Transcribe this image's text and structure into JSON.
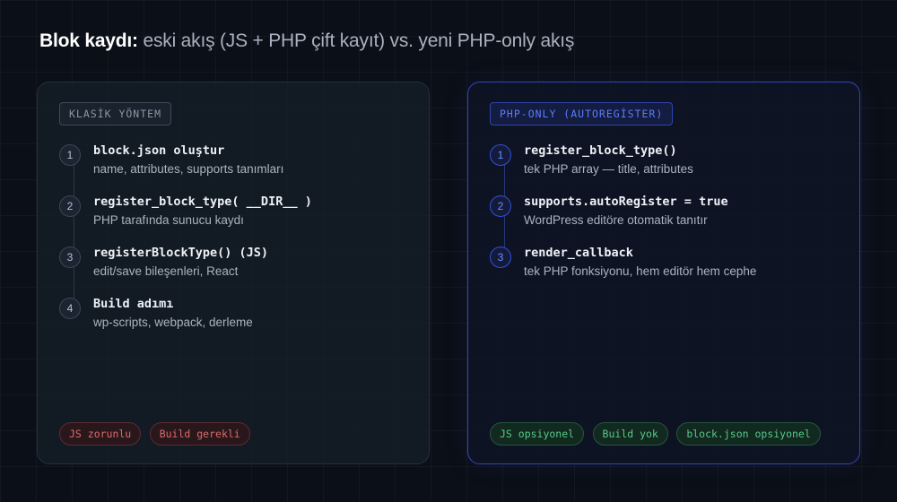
{
  "title": {
    "strong": "Blok kaydı:",
    "rest": "eski akış (JS + PHP çift kayıt) vs. yeni PHP-only akış"
  },
  "left_panel": {
    "label": "KLASİK YÖNTEM",
    "steps": [
      {
        "num": "1",
        "title": "block.json oluştur",
        "desc": "name, attributes, supports tanımları"
      },
      {
        "num": "2",
        "title": "register_block_type( __DIR__ )",
        "desc": "PHP tarafında sunucu kaydı"
      },
      {
        "num": "3",
        "title": "registerBlockType() (JS)",
        "desc": "edit/save bileşenleri, React"
      },
      {
        "num": "4",
        "title": "Build adımı",
        "desc": "wp-scripts, webpack, derleme"
      }
    ],
    "tags": [
      "JS zorunlu",
      "Build gerekli"
    ]
  },
  "right_panel": {
    "label": "PHP-ONLY (AUTOREGİSTER)",
    "steps": [
      {
        "num": "1",
        "title": "register_block_type()",
        "desc": "tek PHP array — title, attributes"
      },
      {
        "num": "2",
        "title": "supports.autoRegister = true",
        "desc": "WordPress editöre otomatik tanıtır"
      },
      {
        "num": "3",
        "title": "render_callback",
        "desc": "tek PHP fonksiyonu, hem editör hem cephe"
      }
    ],
    "tags": [
      "JS opsiyonel",
      "Build yok",
      "block.json opsiyonel"
    ]
  },
  "colors": {
    "background": "#0b0f17",
    "accent_blue": "#3345b8",
    "tag_red": "#d96b6b",
    "tag_green": "#58c98a"
  }
}
